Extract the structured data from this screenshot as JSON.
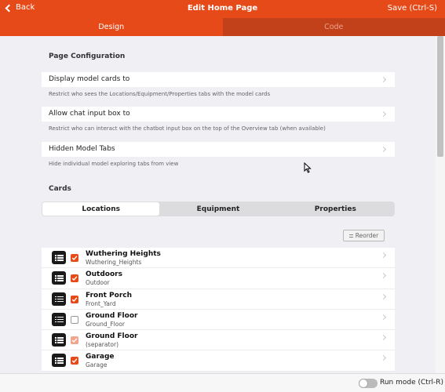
{
  "header": {
    "back_label": "Back",
    "title": "Edit Home Page",
    "save_label": "Save (Ctrl-S)"
  },
  "tabs": [
    {
      "label": "Design",
      "active": true
    },
    {
      "label": "Code",
      "active": false
    }
  ],
  "page_config": {
    "title": "Page Configuration",
    "rows": [
      {
        "label": "Display model cards to",
        "note": "Restrict who sees the Locations/Equipment/Properties tabs with the model cards"
      },
      {
        "label": "Allow chat input box to",
        "note": "Restrict who can interact with the chatbot input box on the top of the Overview tab (when available)"
      },
      {
        "label": "Hidden Model Tabs",
        "note": "Hide individual model exploring tabs from view"
      }
    ]
  },
  "cards": {
    "title": "Cards",
    "segments": [
      {
        "label": "Locations",
        "active": true
      },
      {
        "label": "Equipment",
        "active": false
      },
      {
        "label": "Properties",
        "active": false
      }
    ],
    "reorder_label": "Reorder",
    "items": [
      {
        "name": "Wuthering Heights",
        "sub": "Wuthering_Heights",
        "state": "checked"
      },
      {
        "name": "Outdoors",
        "sub": "Outdoor",
        "state": "checked"
      },
      {
        "name": "Front Porch",
        "sub": "Front_Yard",
        "state": "checked"
      },
      {
        "name": "Ground Floor",
        "sub": "Ground_Floor",
        "state": "unchecked"
      },
      {
        "name": "Ground Floor",
        "sub": "(separator)",
        "state": "dim"
      },
      {
        "name": "Garage",
        "sub": "Garage",
        "state": "checked"
      }
    ]
  },
  "footer": {
    "run_mode_label": "Run mode (Ctrl-R)",
    "run_mode_on": false
  },
  "colors": {
    "accent": "#e64a19",
    "accent_dark": "#c2401a",
    "background": "#efeff4"
  }
}
